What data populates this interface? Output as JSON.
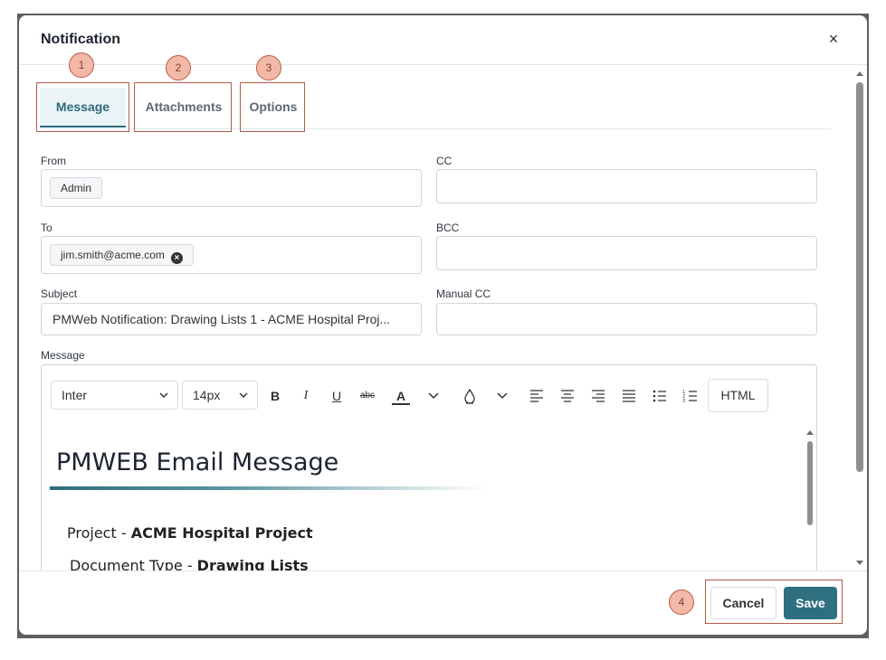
{
  "dialog": {
    "title": "Notification",
    "close_glyph": "×"
  },
  "tabs": [
    {
      "label": "Message",
      "active": true
    },
    {
      "label": "Attachments",
      "active": false
    },
    {
      "label": "Options",
      "active": false
    }
  ],
  "callouts": [
    "1",
    "2",
    "3",
    "4"
  ],
  "form": {
    "from": {
      "label": "From",
      "chips": [
        "Admin"
      ]
    },
    "cc": {
      "label": "CC",
      "value": ""
    },
    "to": {
      "label": "To",
      "chips": [
        "jim.smith@acme.com"
      ]
    },
    "bcc": {
      "label": "BCC",
      "value": ""
    },
    "subject": {
      "label": "Subject",
      "value": "PMWeb Notification: Drawing Lists 1 - ACME Hospital Proj..."
    },
    "manual_cc": {
      "label": "Manual CC",
      "value": ""
    },
    "message": {
      "label": "Message"
    }
  },
  "editor": {
    "font_family": "Inter",
    "font_size": "14px",
    "bold": "B",
    "italic": "I",
    "underline": "U",
    "strikethrough": "abc",
    "text_color": "A",
    "html_button": "HTML",
    "content": {
      "heading": "PMWEB Email Message",
      "project_label": "Project - ",
      "project_value": "ACME Hospital Project",
      "doc_type_label": "Document Type - ",
      "doc_type_value": "Drawing Lists"
    }
  },
  "footer": {
    "cancel_label": "Cancel",
    "save_label": "Save"
  },
  "colors": {
    "accent": "#2f7080",
    "callout_fill": "#f2b8a8",
    "callout_border": "#b25b46"
  }
}
